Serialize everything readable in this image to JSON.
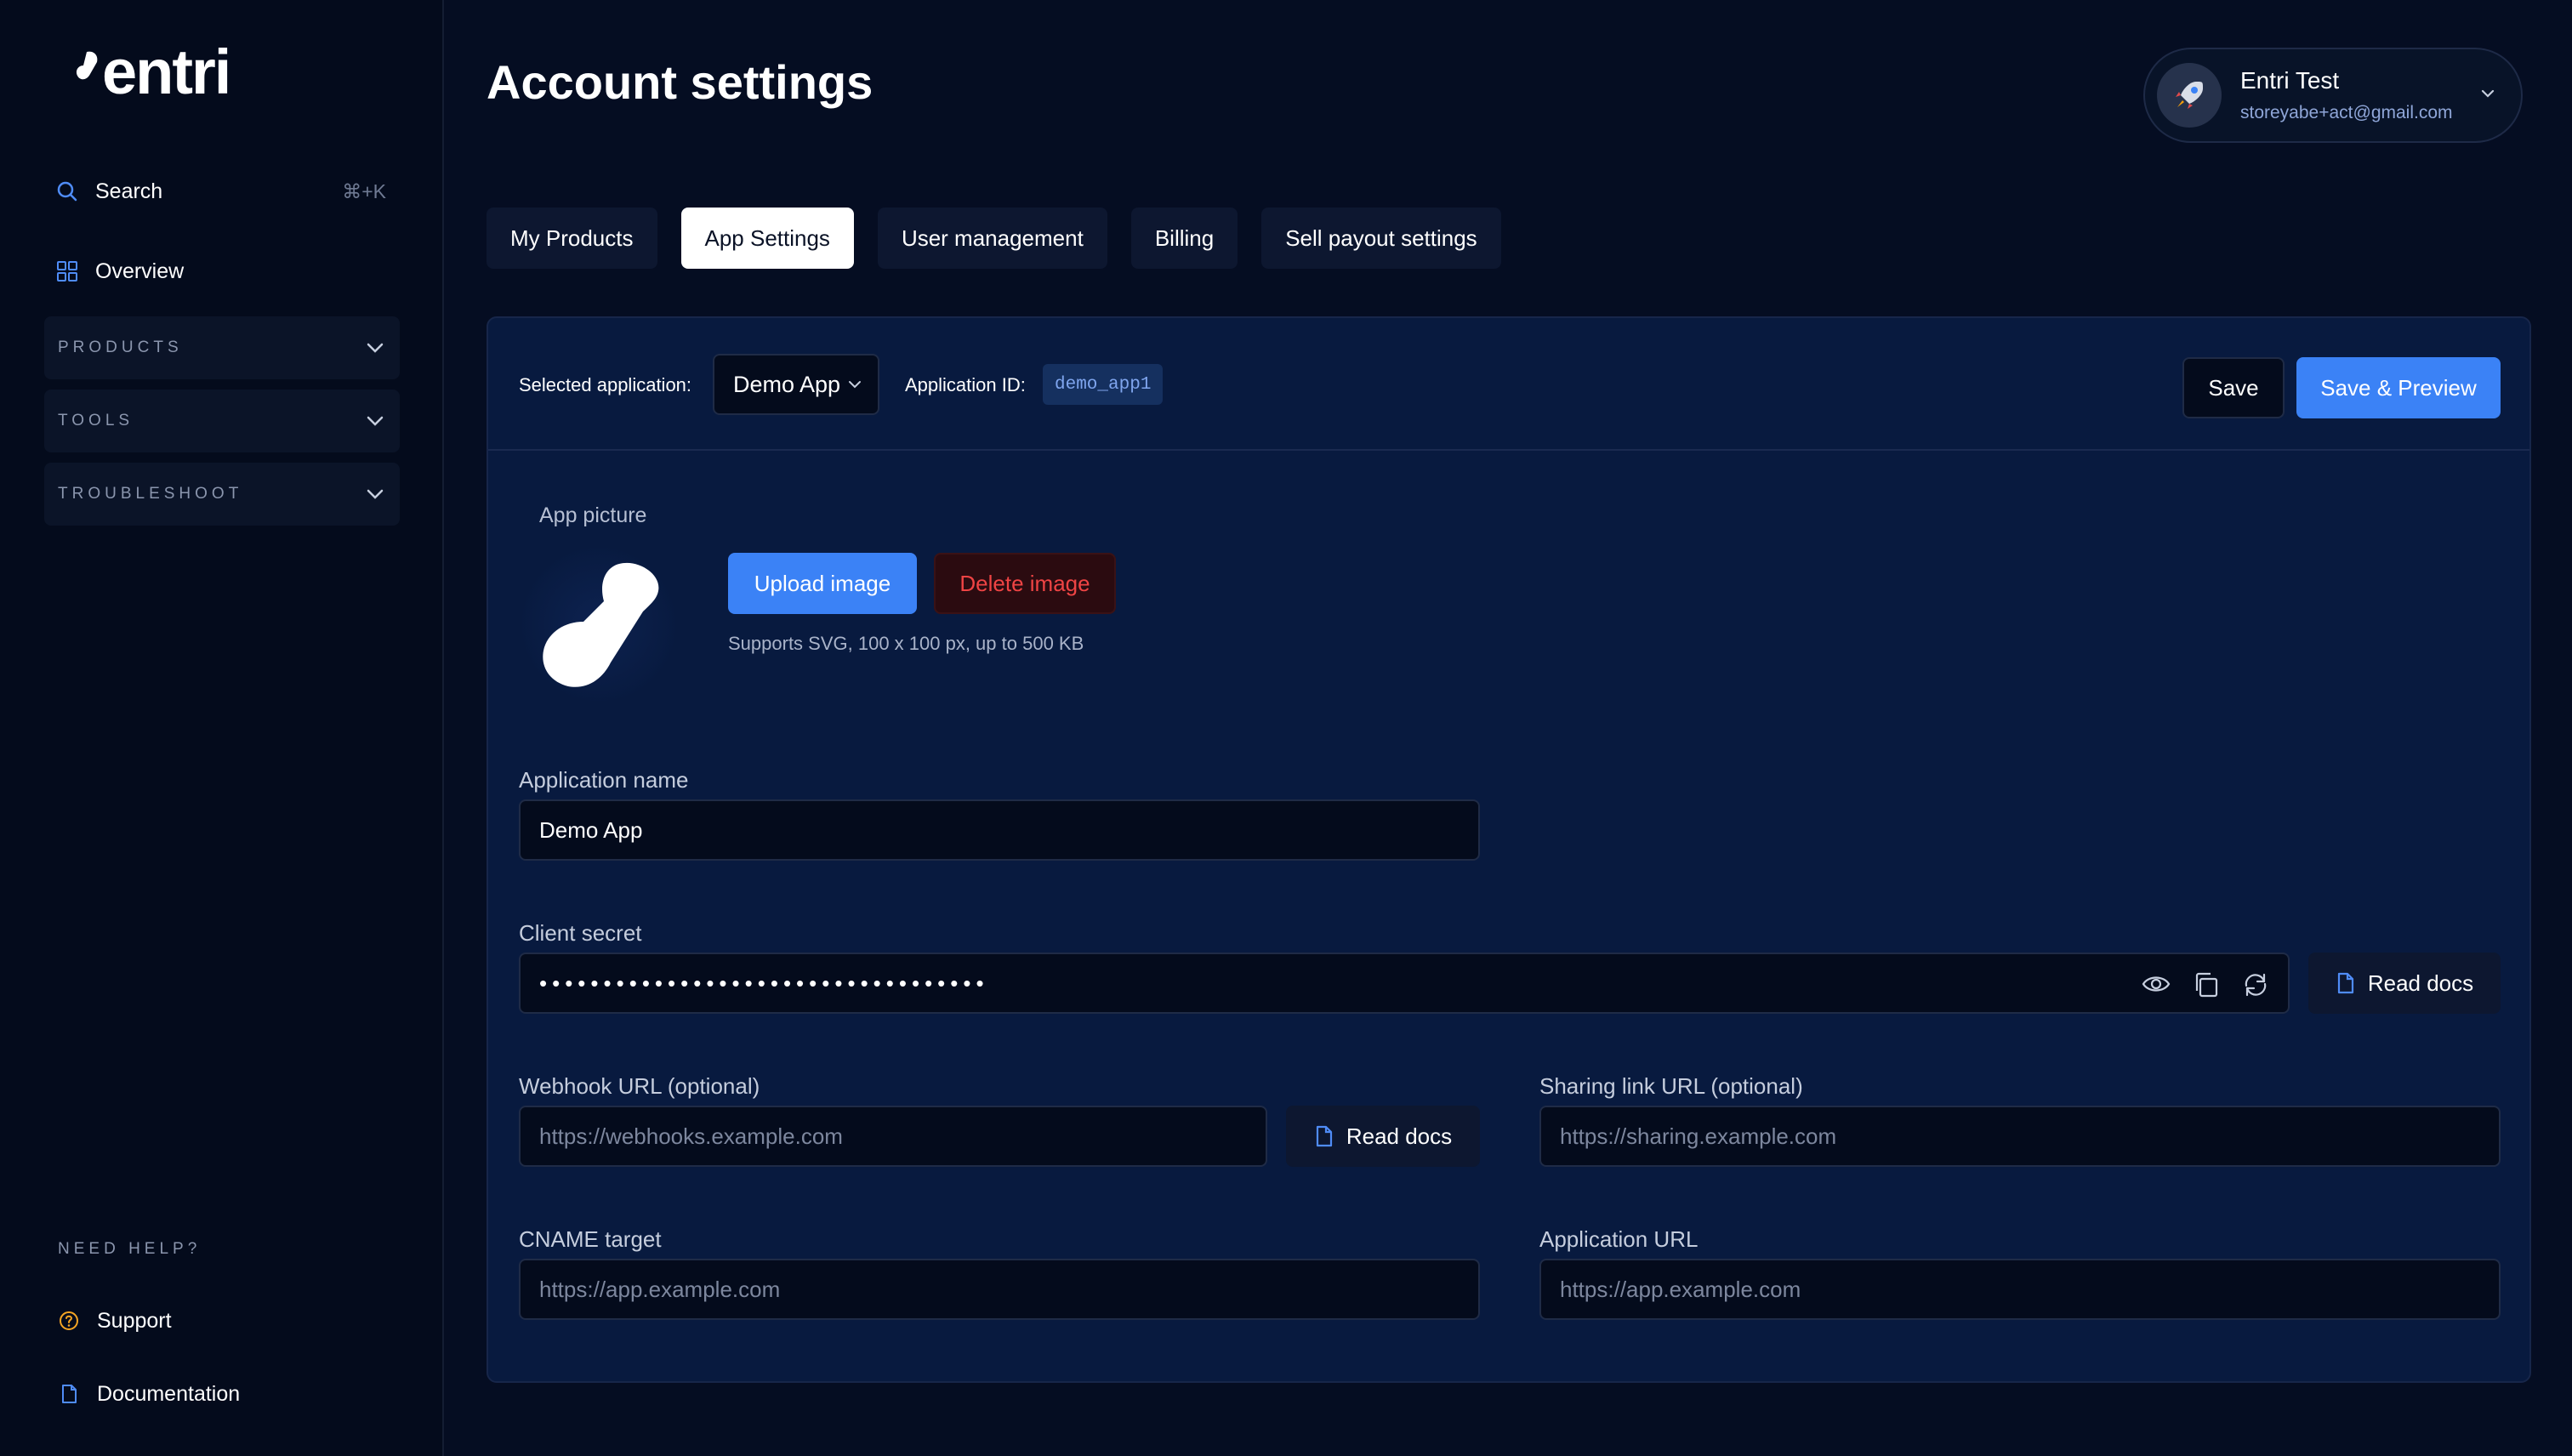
{
  "sidebar": {
    "logo_text": "entri",
    "search": {
      "label": "Search",
      "shortcut": "⌘+K"
    },
    "overview": {
      "label": "Overview"
    },
    "sections": [
      {
        "label": "PRODUCTS"
      },
      {
        "label": "TOOLS"
      },
      {
        "label": "TROUBLESHOOT"
      }
    ],
    "help_heading": "NEED HELP?",
    "support": {
      "label": "Support"
    },
    "documentation": {
      "label": "Documentation"
    }
  },
  "header": {
    "title": "Account settings",
    "user": {
      "name": "Entri Test",
      "email": "storeyabe+act@gmail.com"
    }
  },
  "tabs": [
    {
      "label": "My Products",
      "active": false
    },
    {
      "label": "App Settings",
      "active": true
    },
    {
      "label": "User management",
      "active": false
    },
    {
      "label": "Billing",
      "active": false
    },
    {
      "label": "Sell payout settings",
      "active": false
    }
  ],
  "app_bar": {
    "selected_label": "Selected application:",
    "selected_value": "Demo App",
    "app_id_label": "Application ID:",
    "app_id_value": "demo_app1",
    "save_label": "Save",
    "save_preview_label": "Save & Preview"
  },
  "app_picture": {
    "label": "App picture",
    "upload_label": "Upload image",
    "delete_label": "Delete image",
    "hint": "Supports SVG, 100 x 100 px, up to 500 KB"
  },
  "fields": {
    "app_name": {
      "label": "Application name",
      "value": "Demo App"
    },
    "client_secret": {
      "label": "Client secret",
      "masked_value": "•••••••••••••••••••••••••••••••••••"
    },
    "read_docs_label": "Read docs",
    "webhook": {
      "label": "Webhook URL (optional)",
      "placeholder": "https://webhooks.example.com"
    },
    "sharing": {
      "label": "Sharing link URL (optional)",
      "placeholder": "https://sharing.example.com"
    },
    "cname": {
      "label": "CNAME target",
      "placeholder": "https://app.example.com"
    },
    "app_url": {
      "label": "Application URL",
      "placeholder": "https://app.example.com"
    }
  },
  "colors": {
    "background": "#050d22",
    "sidebar": "#040b1c",
    "card": "#081a3f",
    "accent": "#3b82f6",
    "danger": "#ef4444"
  }
}
